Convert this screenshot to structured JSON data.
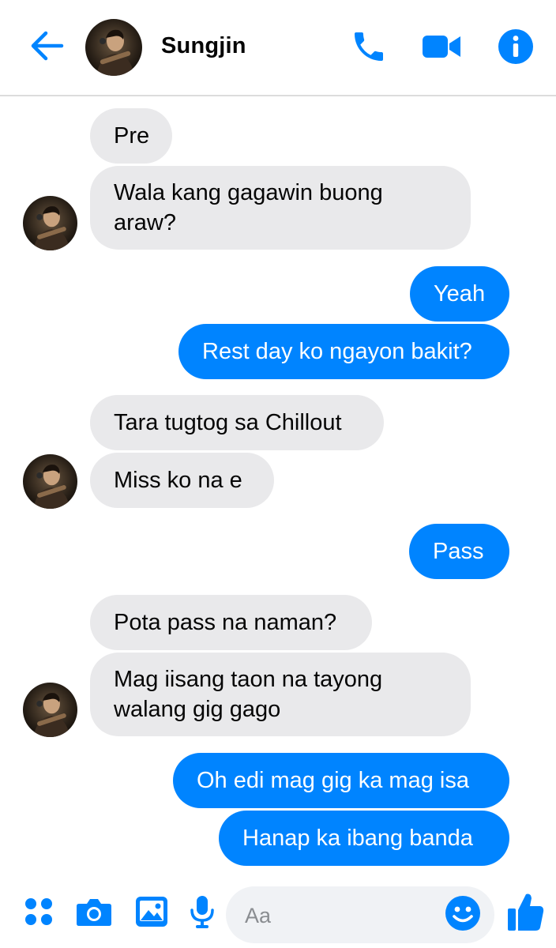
{
  "header": {
    "contact_name": "Sungjin",
    "icons": {
      "back": "arrow-left-icon",
      "call": "phone-icon",
      "video": "video-camera-icon",
      "info": "info-icon"
    }
  },
  "colors": {
    "accent": "#0084ff",
    "incoming_bubble": "#e9e9eb",
    "divider": "#dcdcdc"
  },
  "messages": [
    {
      "direction": "in",
      "text": "Pre"
    },
    {
      "direction": "in",
      "text": "Wala kang gagawin buong araw?"
    },
    {
      "direction": "out",
      "text": "Yeah"
    },
    {
      "direction": "out",
      "text": "Rest day ko ngayon bakit?"
    },
    {
      "direction": "in",
      "text": "Tara tugtog sa Chillout"
    },
    {
      "direction": "in",
      "text": "Miss ko na e"
    },
    {
      "direction": "out",
      "text": "Pass"
    },
    {
      "direction": "in",
      "text": "Pota pass na naman?"
    },
    {
      "direction": "in",
      "text": "Mag iisang taon na tayong walang gig gago"
    },
    {
      "direction": "out",
      "text": "Oh edi mag gig ka mag isa"
    },
    {
      "direction": "out",
      "text": "Hanap ka ibang banda"
    }
  ],
  "composer": {
    "placeholder": "Aa",
    "icons": [
      "apps-grid-icon",
      "camera-icon",
      "gallery-icon",
      "microphone-icon",
      "emoji-icon",
      "thumbs-up-icon"
    ]
  }
}
